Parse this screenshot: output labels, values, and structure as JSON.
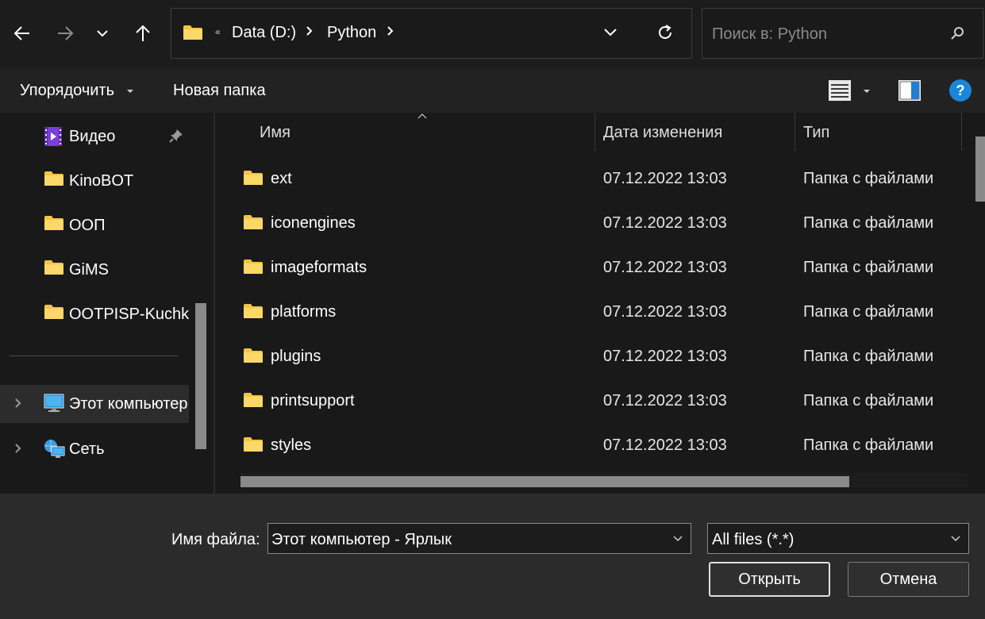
{
  "address": {
    "overflow_glyph": "«",
    "crumbs": [
      "Data (D:)",
      "Python"
    ]
  },
  "search": {
    "placeholder": "Поиск в: Python"
  },
  "commandbar": {
    "organize_label": "Упорядочить",
    "new_folder_label": "Новая папка",
    "help_glyph": "?"
  },
  "navpane": {
    "items": [
      {
        "label": "Видео",
        "icon": "video-folder-icon",
        "pinned": true
      },
      {
        "label": "KinoBOT",
        "icon": "folder-icon"
      },
      {
        "label": "ООП",
        "icon": "folder-icon"
      },
      {
        "label": "GiMS",
        "icon": "folder-icon"
      },
      {
        "label": "OOTPISP-Kuchkov",
        "icon": "folder-icon"
      },
      {
        "label": "Этот компьютер",
        "icon": "this-pc-icon",
        "selected": true
      },
      {
        "label": "Сеть",
        "icon": "network-icon"
      }
    ]
  },
  "filelist": {
    "columns": [
      "Имя",
      "Дата изменения",
      "Тип"
    ],
    "sort_column": "Имя",
    "rows": [
      {
        "name": "ext",
        "date": "07.12.2022 13:03",
        "type": "Папка с файлами"
      },
      {
        "name": "iconengines",
        "date": "07.12.2022 13:03",
        "type": "Папка с файлами"
      },
      {
        "name": "imageformats",
        "date": "07.12.2022 13:03",
        "type": "Папка с файлами"
      },
      {
        "name": "platforms",
        "date": "07.12.2022 13:03",
        "type": "Папка с файлами"
      },
      {
        "name": "plugins",
        "date": "07.12.2022 13:03",
        "type": "Папка с файлами"
      },
      {
        "name": "printsupport",
        "date": "07.12.2022 13:03",
        "type": "Папка с файлами"
      },
      {
        "name": "styles",
        "date": "07.12.2022 13:03",
        "type": "Папка с файлами"
      }
    ]
  },
  "bottom": {
    "filename_label": "Имя файла:",
    "filename_value": "Этот компьютер - Ярлык",
    "filter_value": "All files (*.*)",
    "open_label": "Открыть",
    "cancel_label": "Отмена"
  },
  "colors": {
    "background": "#191919",
    "folder": "#f5c445",
    "help_accent": "#1a86d9"
  }
}
